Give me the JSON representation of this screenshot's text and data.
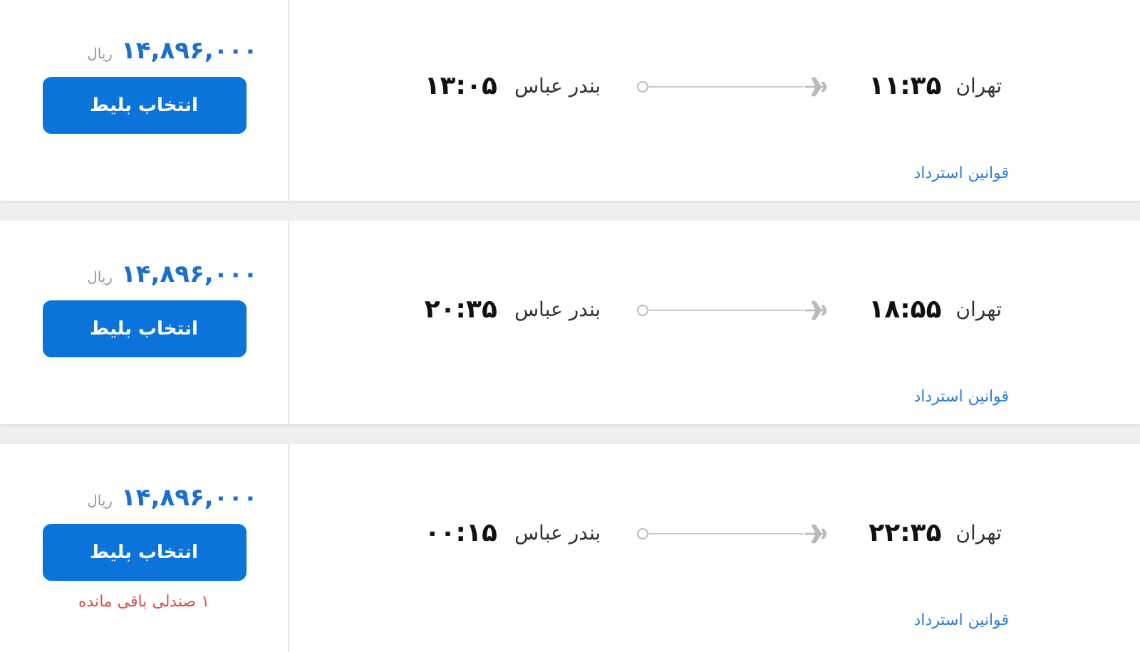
{
  "flights": [
    {
      "price": "۱۴,۸۹۶,۰۰۰",
      "currency": "ریال",
      "button": "انتخاب بلیط",
      "origin": {
        "city": "تهران",
        "time": "۱۱:۳۵"
      },
      "destination": {
        "city": "بندر عباس",
        "time": "۱۳:۰۵"
      },
      "refund_link": "قوانین استرداد"
    },
    {
      "price": "۱۴,۸۹۶,۰۰۰",
      "currency": "ریال",
      "button": "انتخاب بلیط",
      "origin": {
        "city": "تهران",
        "time": "۱۸:۵۵"
      },
      "destination": {
        "city": "بندر عباس",
        "time": "۲۰:۳۵"
      },
      "refund_link": "قوانین استرداد"
    },
    {
      "price": "۱۴,۸۹۶,۰۰۰",
      "currency": "ریال",
      "button": "انتخاب بلیط",
      "origin": {
        "city": "تهران",
        "time": "۲۲:۳۵"
      },
      "destination": {
        "city": "بندر عباس",
        "time": "۰۰:۱۵"
      },
      "refund_link": "قوانین استرداد",
      "seats_left": "۱ صندلی باقی مانده"
    }
  ]
}
